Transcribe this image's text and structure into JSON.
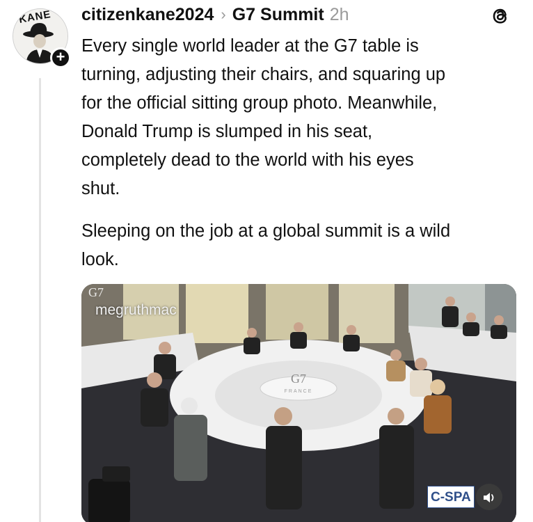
{
  "post": {
    "username": "citizenkane2024",
    "topic": "G7 Summit",
    "time": "2h",
    "avatar_text": "KANE",
    "paragraph1_lines": [
      "Every single world leader at the G7 table is",
      "turning, adjusting their chairs, and squaring up",
      "for the official sitting group photo. Meanwhile,",
      "Donald Trump is slumped in his seat,",
      "completely dead to the world with his eyes",
      "shut."
    ],
    "paragraph2_lines": [
      "Sleeping on the job at a global summit is a wild",
      "look."
    ]
  },
  "media": {
    "watermark": "megruthmac",
    "logo_text": "G7",
    "logo_sub": "FRANCE",
    "broadcaster": "C-SPA"
  },
  "icons": {
    "threads": "threads-logo-icon",
    "follow": "plus-icon",
    "chevron": "chevron-right-icon",
    "sound": "speaker-icon"
  }
}
